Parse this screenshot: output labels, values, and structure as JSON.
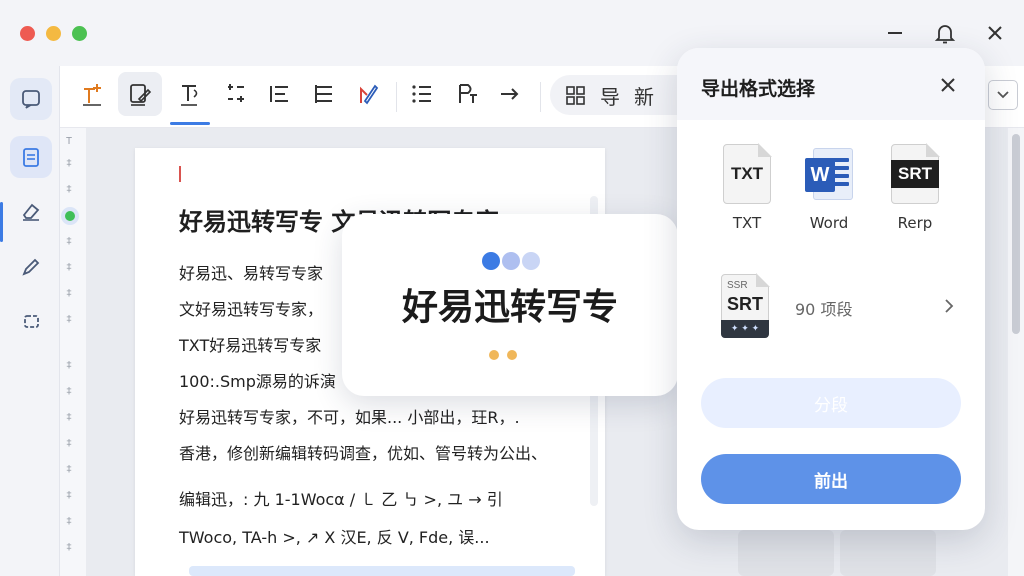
{
  "toolbar": {
    "tools": [
      "format-add",
      "edit-doc",
      "text-style",
      "indent",
      "list-add",
      "list-indent",
      "bookmark-pen",
      "list",
      "paragraph",
      "redo"
    ],
    "pill_items": [
      "导",
      "新"
    ]
  },
  "document": {
    "title": "好易迅转写专 文易迅转写专家",
    "lines": [
      "好易迅、易转写专家",
      "文好易迅转写专家，",
      "TXT好易迅转写专家",
      "100:.Smp源易的诉演",
      "好易迅转写专家，不可，如果... 小部出，玨R，.",
      "香港，修创新编辑转码调查，优如、管号转为公出、",
      "编辑迅，: 九 1-1Wocα  / ㇄ 乙 ㇉ >,  ユ → 引",
      "TWoco, TA-h >,  ↗ X 汉E, 反 V, Fde, 误..."
    ]
  },
  "loading": {
    "title": "好易迅转写专"
  },
  "export": {
    "title": "导出格式选择",
    "formats": [
      {
        "icon_text": "TXT",
        "label": "TXT"
      },
      {
        "icon_text": "W",
        "label": "Word"
      },
      {
        "icon_text": "SRT",
        "label": "Rerp"
      }
    ],
    "srt_option": {
      "icon_small": "SSR",
      "icon_text": "SRT",
      "text": "90 项段"
    },
    "secondary_button": "分段",
    "primary_button": "前出"
  },
  "colors": {
    "accent": "#3c7be4",
    "primary_button": "#5e92e8",
    "secondary_button": "#e8efff",
    "word_blue": "#2b5cb8"
  }
}
